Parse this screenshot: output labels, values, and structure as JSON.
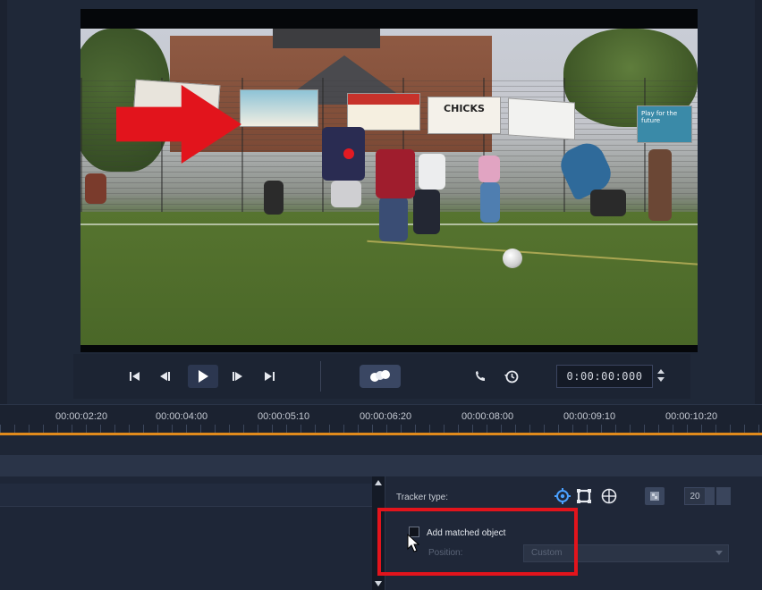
{
  "player": {
    "timecode": "0:00:00:000",
    "controls": {
      "to_start": "go-to-start-icon",
      "prev_frame": "previous-frame-icon",
      "play": "play-icon",
      "next_frame": "next-frame-icon",
      "to_end": "go-to-end-icon",
      "effects": "motion-dots-icon",
      "phone": "phone-icon",
      "history": "history-icon"
    }
  },
  "video": {
    "banner_text": "CHICKS",
    "banner_right_text": "Play for the future"
  },
  "timeline": {
    "ticks": [
      "00:00:02:20",
      "00:00:04:00",
      "00:00:05:10",
      "00:00:06:20",
      "00:00:08:00",
      "00:00:09:10",
      "00:00:10:20"
    ],
    "playhead_color": "#e08a1c"
  },
  "tracker": {
    "label": "Tracker type:",
    "types": [
      "crosshair-icon",
      "square-frame-icon",
      "globe-icon"
    ],
    "size_value": "20"
  },
  "matched_object": {
    "checkbox_label": "Add matched object",
    "checked": false,
    "position_label": "Position:",
    "position_value": "Custom"
  },
  "colors": {
    "highlight_red": "#e2141c",
    "accent_blue": "#4aa0ff"
  }
}
